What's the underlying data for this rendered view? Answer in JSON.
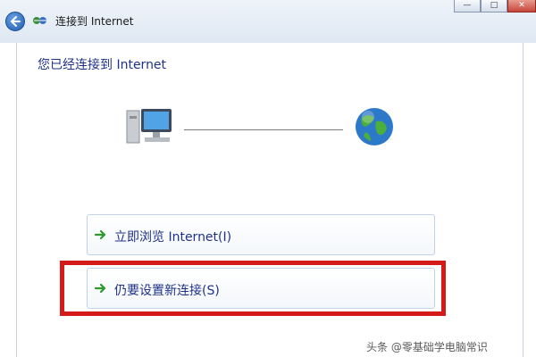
{
  "window": {
    "title": "连接到 Internet",
    "controls": {
      "minimize": "—",
      "maximize": "□",
      "close": "✕"
    }
  },
  "main": {
    "heading": "您已经连接到 Internet",
    "status_graphic": {
      "left_icon": "computer-icon",
      "right_icon": "globe-icon"
    },
    "options": [
      {
        "label": "立即浏览 Internet(I)",
        "icon": "green-arrow-icon"
      },
      {
        "label": "仍要设置新连接(S)",
        "icon": "green-arrow-icon",
        "highlighted": true
      }
    ]
  },
  "annotation": {
    "highlight_color": "#d51a1a"
  },
  "watermark": {
    "text": "头条 @零基础学电脑常识"
  },
  "colors": {
    "link_blue": "#1e3287",
    "arrow_green": "#2e9a2e"
  }
}
